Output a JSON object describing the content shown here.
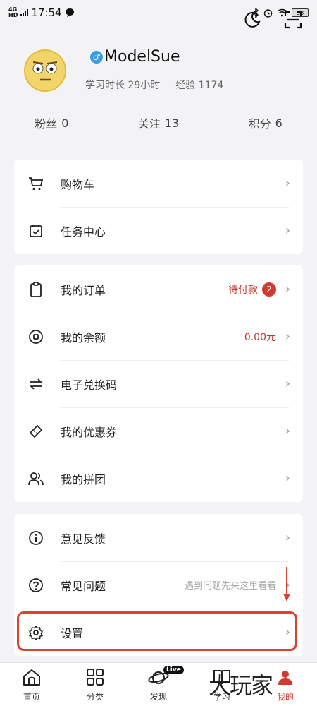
{
  "status_bar": {
    "network": "4G",
    "network_sub": "HD",
    "time": "17:54",
    "battery": "98"
  },
  "profile": {
    "username": "ModelSue",
    "study_time": "学习时长 29小时",
    "experience": "经验 1174"
  },
  "stats": [
    {
      "label": "粉丝",
      "value": "0"
    },
    {
      "label": "关注",
      "value": "13"
    },
    {
      "label": "积分",
      "value": "6"
    }
  ],
  "cards": {
    "shopping": {
      "cart": "购物车",
      "tasks": "任务中心"
    },
    "orders": {
      "my_orders": "我的订单",
      "pending_label": "待付款",
      "pending_count": "2",
      "balance": "我的余额",
      "balance_value": "0.00元",
      "redeem": "电子兑换码",
      "coupons": "我的优惠券",
      "group_buy": "我的拼团"
    },
    "support": {
      "feedback": "意见反馈",
      "faq": "常见问题",
      "faq_hint": "遇到问题先来这里看看",
      "settings": "设置"
    }
  },
  "tabbar": {
    "home": "首页",
    "category": "分类",
    "discover": "发现",
    "discover_badge": "Live",
    "study": "学习",
    "mine": "我的"
  },
  "watermark": "大玩家",
  "colors": {
    "accent_red": "#d03a31",
    "highlight": "#d9432f",
    "background": "#f3f3f5"
  }
}
